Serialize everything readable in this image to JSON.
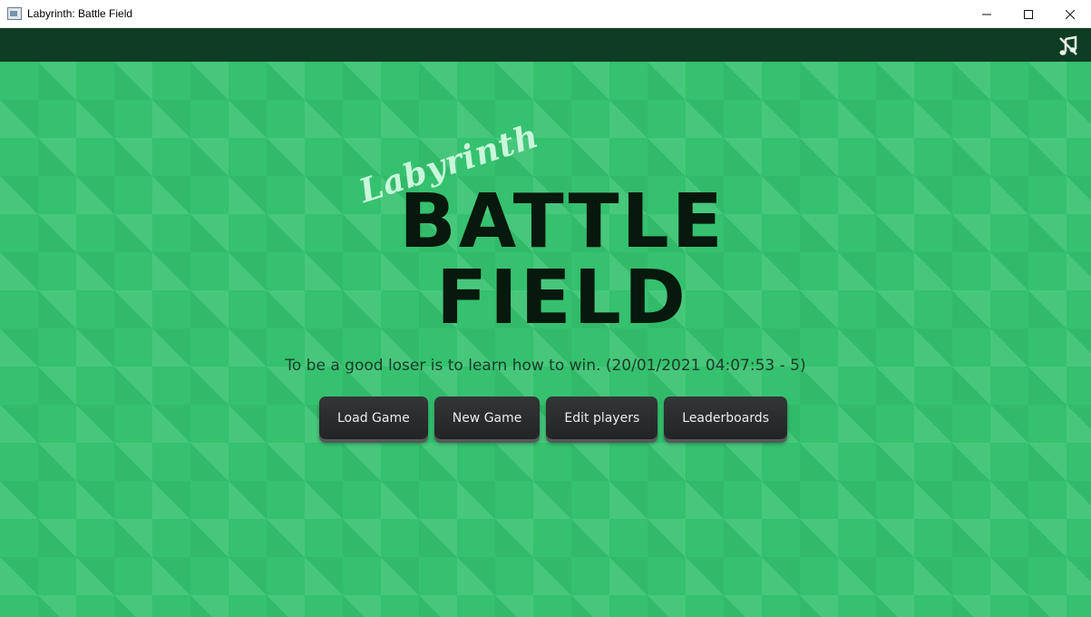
{
  "window": {
    "title": "Labyrinth: Battle Field",
    "icon": "app-icon"
  },
  "appbar": {
    "music_toggle_icon": "music-off-icon",
    "background": "#0f3d24"
  },
  "logo": {
    "subtitle": "Labyrinth",
    "line1": "BATTLE",
    "line2": "FIELD"
  },
  "quote": "To be a good loser is to learn how to win. (20/01/2021 04:07:53 - 5)",
  "menu": {
    "load_game": "Load Game",
    "new_game": "New Game",
    "edit_players": "Edit players",
    "leaderboards": "Leaderboards"
  },
  "colors": {
    "background_green": "#35c16f",
    "logo_dark": "#07180c",
    "button_dark": "#2b2c2e"
  }
}
